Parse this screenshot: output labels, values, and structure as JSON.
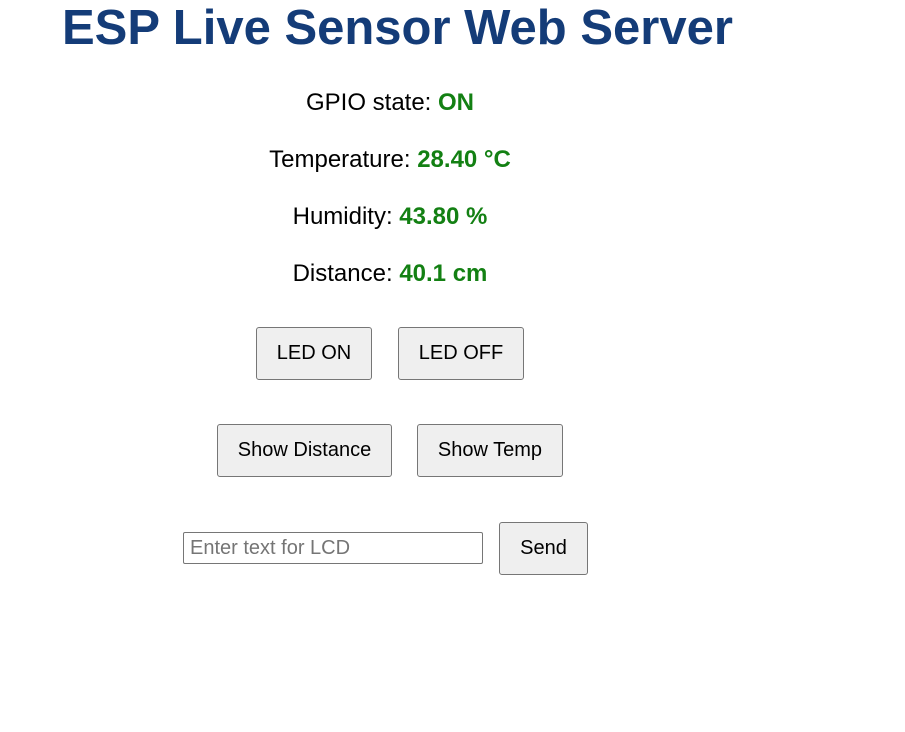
{
  "header": {
    "title": "ESP Live Sensor Web Server"
  },
  "readings": {
    "gpio": {
      "label": "GPIO state: ",
      "value": "ON"
    },
    "temperature": {
      "label": "Temperature: ",
      "value": "28.40 °C"
    },
    "humidity": {
      "label": "Humidity: ",
      "value": "43.80 %"
    },
    "distance": {
      "label": "Distance: ",
      "value": "40.1 cm"
    }
  },
  "controls": {
    "led_on_label": "LED ON",
    "led_off_label": "LED OFF",
    "show_distance_label": "Show Distance",
    "show_temp_label": "Show Temp"
  },
  "lcd": {
    "placeholder": "Enter text for LCD",
    "value": "",
    "send_label": "Send"
  },
  "colors": {
    "title": "#143c78",
    "value": "#138013"
  }
}
